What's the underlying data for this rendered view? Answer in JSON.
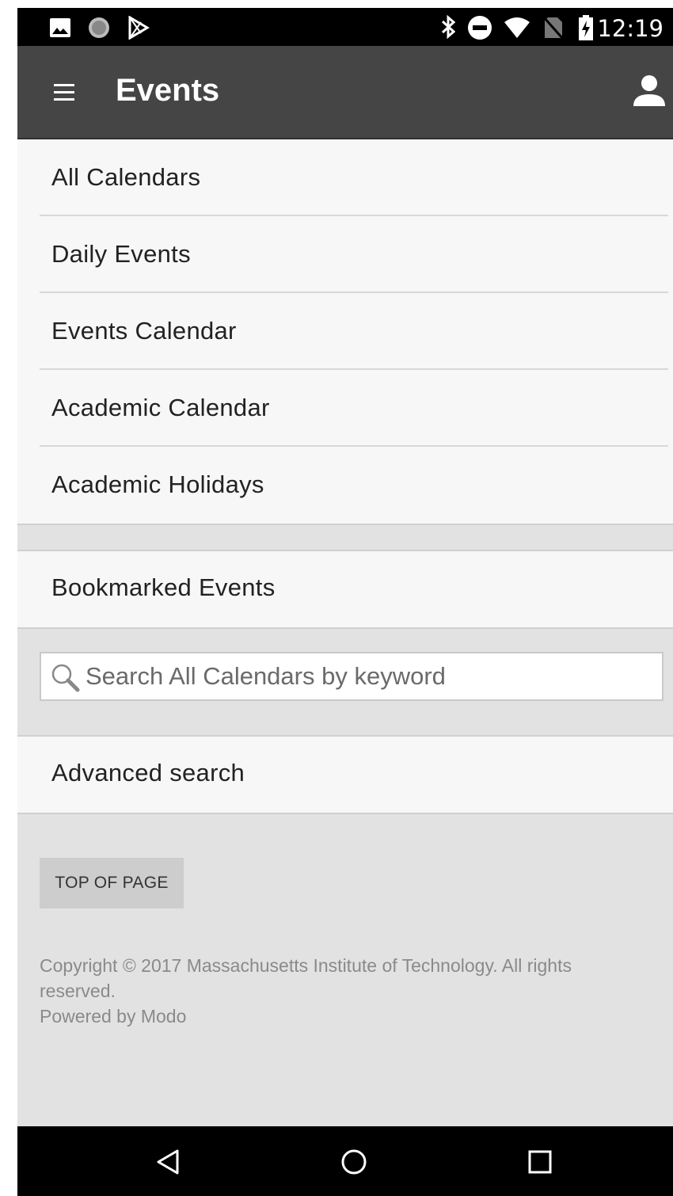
{
  "status_bar": {
    "time": "12:19",
    "left_icons": [
      "image-icon",
      "circle-icon",
      "play-store-icon"
    ],
    "right_icons": [
      "bluetooth-icon",
      "do-not-disturb-icon",
      "wifi-icon",
      "no-sim-icon",
      "battery-charging-icon"
    ]
  },
  "app_bar": {
    "title": "Events",
    "menu_icon": "hamburger-menu-icon",
    "account_icon": "person-icon",
    "background": "#454545"
  },
  "calendars": [
    {
      "label": "All Calendars"
    },
    {
      "label": "Daily Events"
    },
    {
      "label": "Events Calendar"
    },
    {
      "label": "Academic Calendar"
    },
    {
      "label": "Academic Holidays"
    }
  ],
  "bookmarked": {
    "label": "Bookmarked Events"
  },
  "search": {
    "placeholder": "Search All Calendars by keyword",
    "value": ""
  },
  "advanced_search": {
    "label": "Advanced search"
  },
  "top_of_page": {
    "label": "TOP OF PAGE"
  },
  "footer": {
    "copyright_line1": "Copyright © 2017 Massachusetts Institute of Technology. All rights",
    "copyright_line2": "reserved.",
    "powered_by": "Powered by Modo"
  },
  "nav_bar": {
    "buttons": [
      "back-icon",
      "home-icon",
      "recents-icon"
    ]
  }
}
